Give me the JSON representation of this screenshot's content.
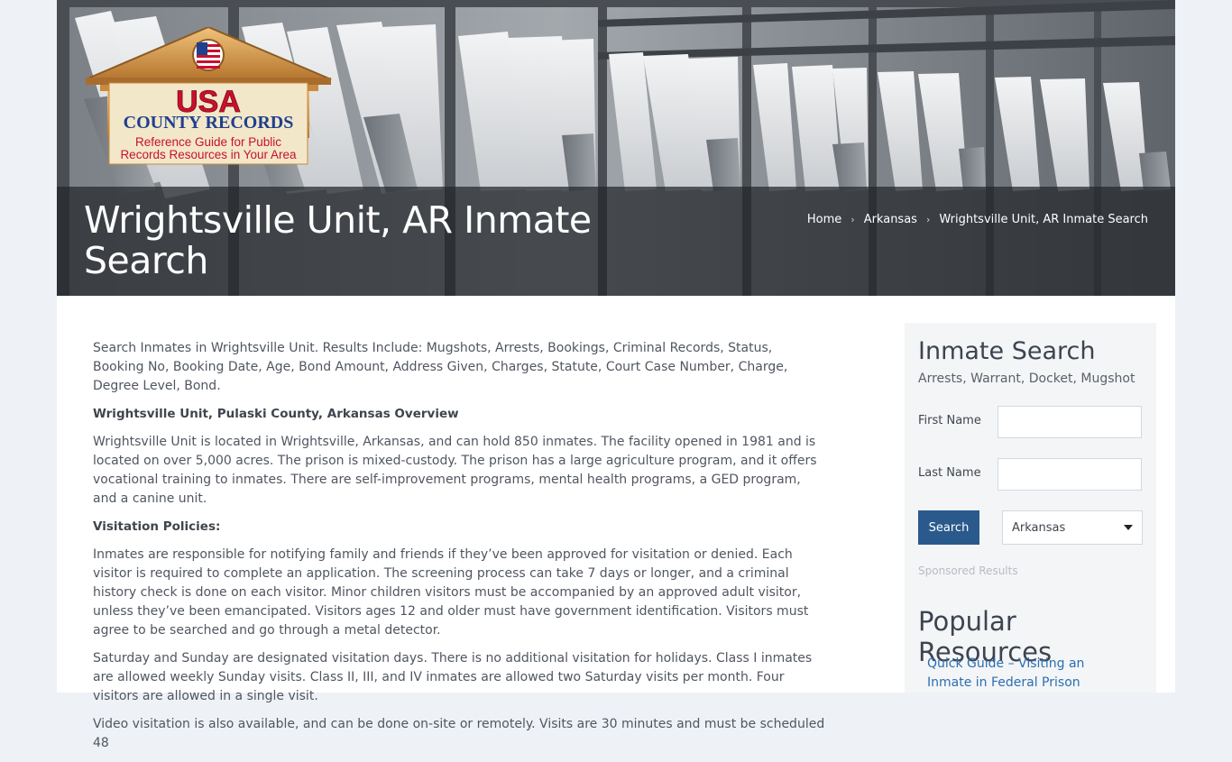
{
  "hero": {
    "title": "Wrightsville Unit, AR Inmate Search",
    "breadcrumb": [
      "Home",
      "Arkansas",
      "Wrightsville Unit, AR Inmate Search"
    ]
  },
  "logo": {
    "brand_line1": "USA",
    "brand_line2": "COUNTY RECORDS",
    "tagline_line1": "Reference Guide for Public",
    "tagline_line2": "Records Resources in Your Area"
  },
  "content": {
    "paragraphs": [
      "Search Inmates in Wrightsville Unit. Results Include: Mugshots, Arrests, Bookings, Criminal Records, Status, Booking No, Booking Date, Age, Bond Amount, Address Given, Charges, Statute, Court Case Number, Charge, Degree Level, Bond.",
      "Wrightsville Unit, Pulaski County, Arkansas Overview",
      "Wrightsville Unit is located in Wrightsville, Arkansas, and can hold 850 inmates. The facility opened in 1981 and is located on over 5,000 acres. The prison is mixed-custody. The prison has a large agriculture program, and it offers vocational training to inmates. There are self-improvement programs, mental health programs, a GED program, and a canine unit.",
      "Visitation Policies:",
      "Inmates are responsible for notifying family and friends if they’ve been approved for visitation or denied. Each visitor is required to complete an application. The screening process can take 7 days or longer, and a criminal history check is done on each visitor. Minor children visitors must be accompanied by an approved adult visitor, unless they’ve been emancipated. Visitors ages 12 and older must have government identification. Visitors must agree to be searched and go through a metal detector.",
      "Saturday and Sunday are designated visitation days. There is no additional visitation for holidays. Class I inmates are allowed weekly Sunday visits. Class II, III, and IV inmates are allowed two Saturday visits per month. Four visitors are allowed in a single visit.",
      "Video visitation is also available, and can be done on-site or remotely. Visits are 30 minutes and must be scheduled 48"
    ]
  },
  "sidebar": {
    "title": "Inmate Search",
    "subtitle": "Arrests, Warrant, Docket, Mugshot",
    "first_name_label": "First Name",
    "first_name_value": "",
    "last_name_label": "Last Name",
    "last_name_value": "",
    "search_label": "Search",
    "state_selected": "Arkansas",
    "sponsored": "Sponsored Results",
    "popular_title": "Popular Resources",
    "popular_link": "Quick Guide – Visiting an Inmate in Federal Prison"
  },
  "colors": {
    "accent": "#2a5a8c",
    "link": "#2a6fb0",
    "logo_red": "#c8102e",
    "logo_blue": "#1f3f8f",
    "logo_gold": "#c98a3e"
  }
}
